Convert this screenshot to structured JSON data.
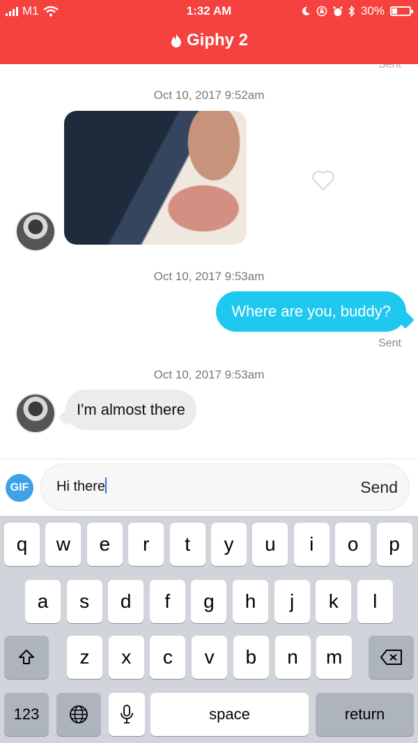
{
  "status_bar": {
    "carrier": "M1",
    "time": "1:32 AM",
    "battery": "30%",
    "battery_level": 0.3
  },
  "header": {
    "title": "Giphy 2",
    "icon": "flame-icon"
  },
  "chat": {
    "top_sent_label": "Sent",
    "messages": [
      {
        "timestamp": "Oct 10, 2017 9:52am",
        "type": "gif",
        "from": "them",
        "liked": false
      },
      {
        "timestamp": "Oct 10, 2017 9:53am",
        "type": "text",
        "from": "me",
        "text": "Where are you, buddy?",
        "status": "Sent"
      },
      {
        "timestamp": "Oct 10, 2017 9:53am",
        "type": "text",
        "from": "them",
        "text": "I'm almost there"
      }
    ]
  },
  "composer": {
    "gif_label": "GIF",
    "value": "Hi there",
    "send_label": "Send"
  },
  "keyboard": {
    "row1": [
      "q",
      "w",
      "e",
      "r",
      "t",
      "y",
      "u",
      "i",
      "o",
      "p"
    ],
    "row2": [
      "a",
      "s",
      "d",
      "f",
      "g",
      "h",
      "j",
      "k",
      "l"
    ],
    "row3": [
      "z",
      "x",
      "c",
      "v",
      "b",
      "n",
      "m"
    ],
    "numbers_label": "123",
    "space_label": "space",
    "return_label": "return"
  },
  "colors": {
    "header": "#f5423f",
    "outgoing_bubble": "#1fc8ef",
    "incoming_bubble": "#ececec",
    "gif_button": "#3ea2ea"
  }
}
